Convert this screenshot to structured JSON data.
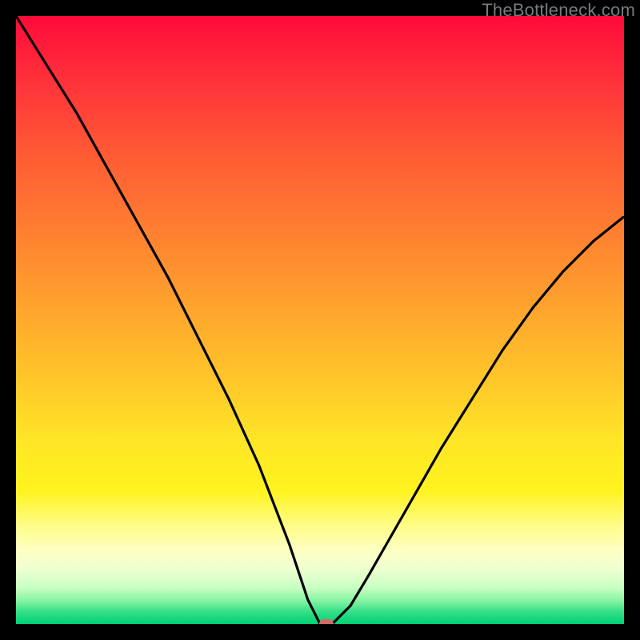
{
  "watermark": "TheBottleneck.com",
  "colors": {
    "curve_stroke": "#000000",
    "marker_fill": "#d46a6a",
    "frame_bg": "#000000"
  },
  "chart_data": {
    "type": "line",
    "title": "",
    "xlabel": "",
    "ylabel": "",
    "xlim": [
      0,
      100
    ],
    "ylim": [
      0,
      100
    ],
    "grid": false,
    "legend": false,
    "series": [
      {
        "name": "bottleneck-curve",
        "x": [
          0,
          5,
          10,
          15,
          20,
          25,
          30,
          35,
          40,
          45,
          48,
          50,
          52,
          55,
          58,
          62,
          66,
          70,
          75,
          80,
          85,
          90,
          95,
          100
        ],
        "values": [
          100,
          92,
          84,
          75,
          66,
          57,
          47,
          37,
          26,
          13,
          4,
          0,
          0,
          3,
          8,
          15,
          22,
          29,
          37,
          45,
          52,
          58,
          63,
          67
        ]
      }
    ],
    "annotations": [
      {
        "name": "min-marker",
        "x": 51,
        "y": 0
      }
    ]
  }
}
